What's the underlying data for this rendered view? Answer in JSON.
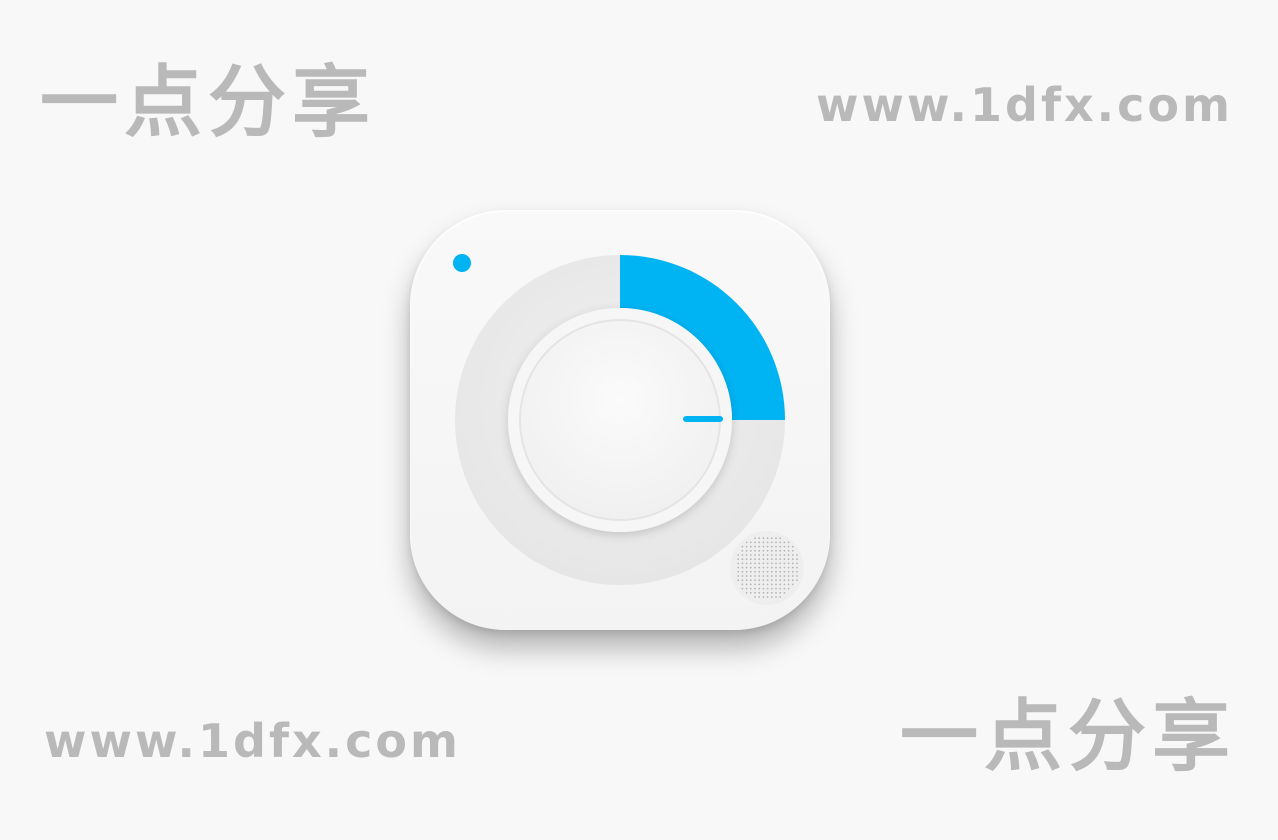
{
  "watermarks": {
    "top_left": "一点分享",
    "top_right": "www.1dfx.com",
    "bottom_left": "www.1dfx.com",
    "bottom_right": "一点分享"
  },
  "app_icon": {
    "icon": "timer-dial-icon",
    "progress_fraction": 0.25,
    "colors": {
      "accent": "#00b4f4",
      "ring": "#ebebeb",
      "body": "#f5f5f5",
      "watermark": "#b9b9b9"
    }
  }
}
